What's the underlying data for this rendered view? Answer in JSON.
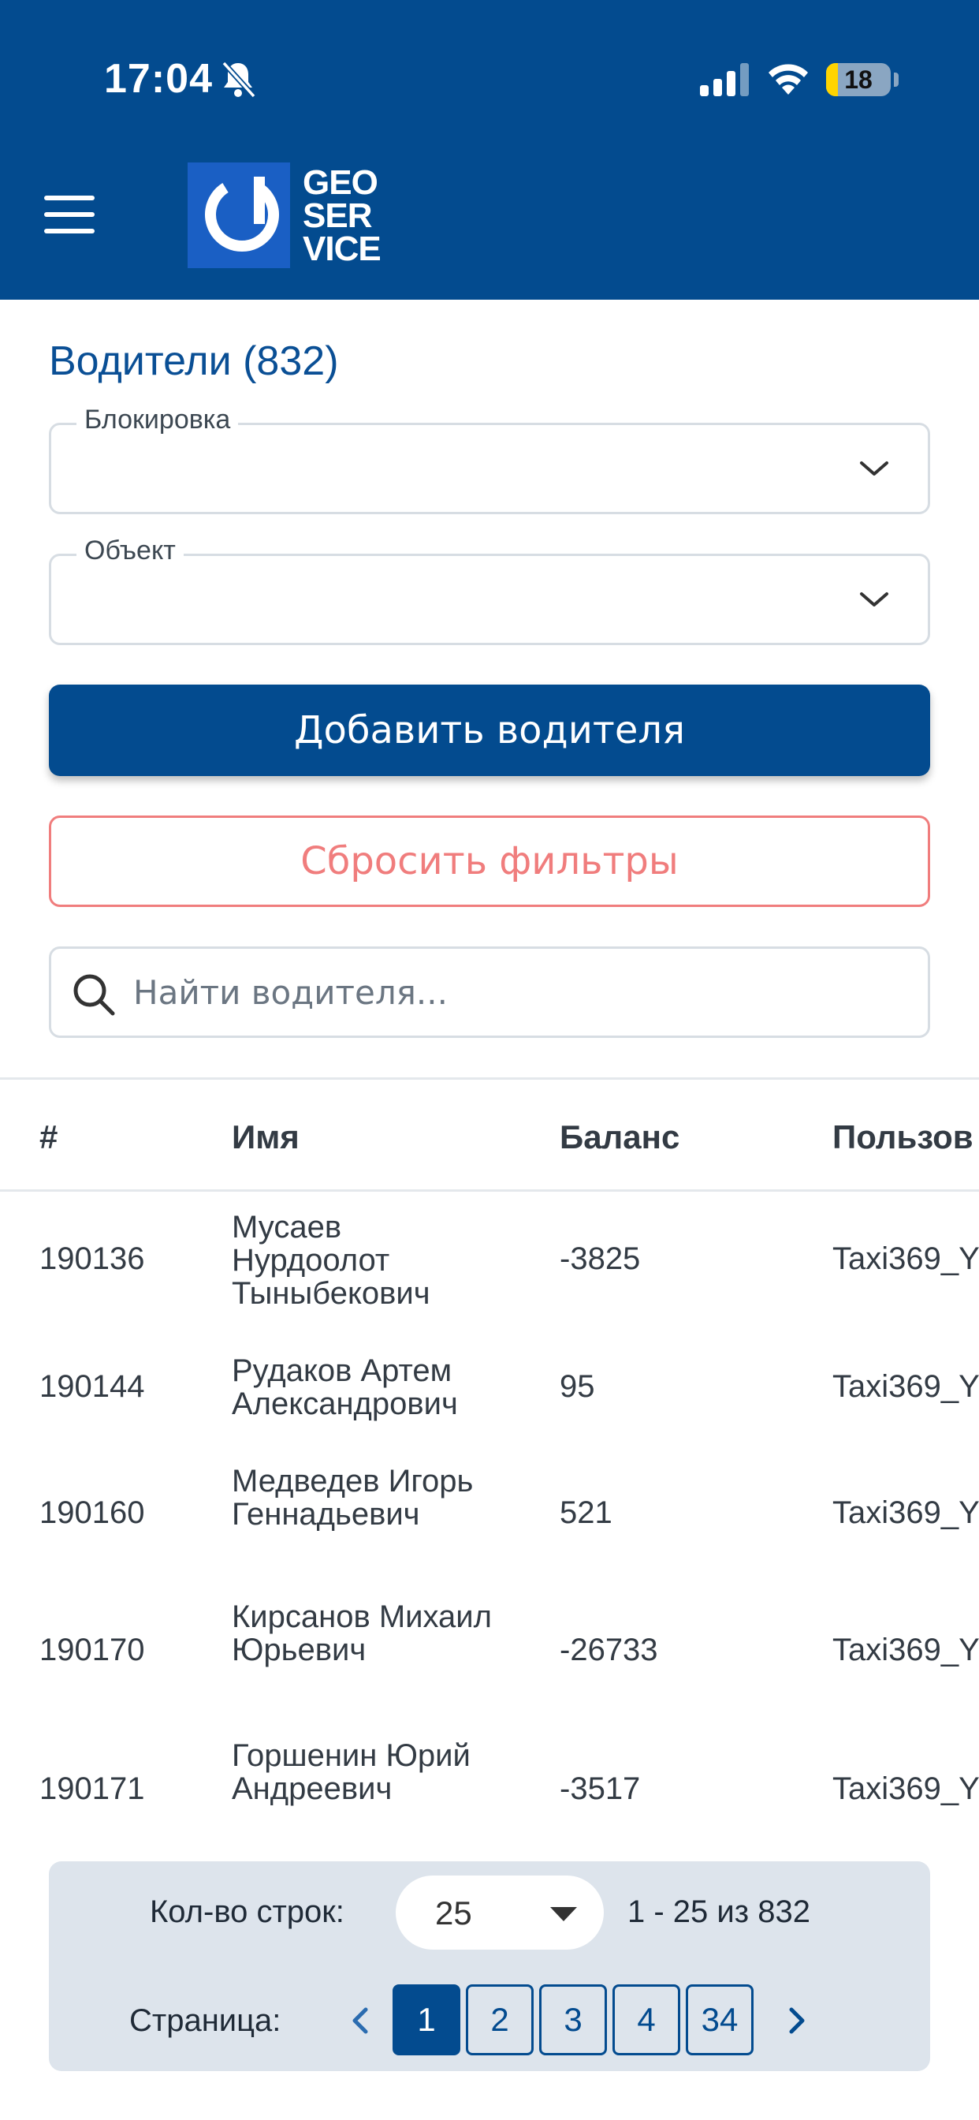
{
  "status_bar": {
    "time": "17:04",
    "battery": "18",
    "battery_level_percent": 18,
    "icons": [
      "bell-slash-icon",
      "signal-icon",
      "wifi-icon",
      "battery-icon"
    ]
  },
  "header": {
    "logo_lines": [
      "GEO",
      "SER",
      "VICE"
    ],
    "colors": {
      "header_bg": "#034b8f",
      "accent": "#034b8f",
      "danger": "#f07d7d"
    }
  },
  "page": {
    "title": "Водители (832)"
  },
  "filters": {
    "block_label": "Блокировка",
    "block_value": "",
    "object_label": "Объект",
    "object_value": ""
  },
  "actions": {
    "add_driver": "Добавить водителя",
    "reset_filters": "Сбросить фильтры"
  },
  "search": {
    "placeholder": "Найти водителя...",
    "value": ""
  },
  "table": {
    "columns": [
      "#",
      "Имя",
      "Баланс",
      "Пользов"
    ],
    "rows": [
      {
        "id": "190136",
        "name": "Мусаев Нурдоолот Тыныбекович",
        "balance": "-3825",
        "user": "Taxi369_Y"
      },
      {
        "id": "190144",
        "name": "Рудаков Артем Александрович",
        "balance": "95",
        "user": "Taxi369_Y"
      },
      {
        "id": "190160",
        "name": "Медведев Игорь Геннадьевич",
        "balance": "521",
        "user": "Taxi369_Y"
      },
      {
        "id": "190170",
        "name": "Кирсанов Михаил Юрьевич",
        "balance": "-26733",
        "user": "Taxi369_Y"
      },
      {
        "id": "190171",
        "name": "Горшенин Юрий Андреевич",
        "balance": "-3517",
        "user": "Taxi369_Y"
      }
    ]
  },
  "pagination": {
    "rows_label": "Кол-во строк:",
    "rows_per_page": "25",
    "range": "1 - 25 из 832",
    "page_label": "Страница:",
    "pages": [
      "1",
      "2",
      "3",
      "4",
      "34"
    ],
    "current_page": "1"
  }
}
